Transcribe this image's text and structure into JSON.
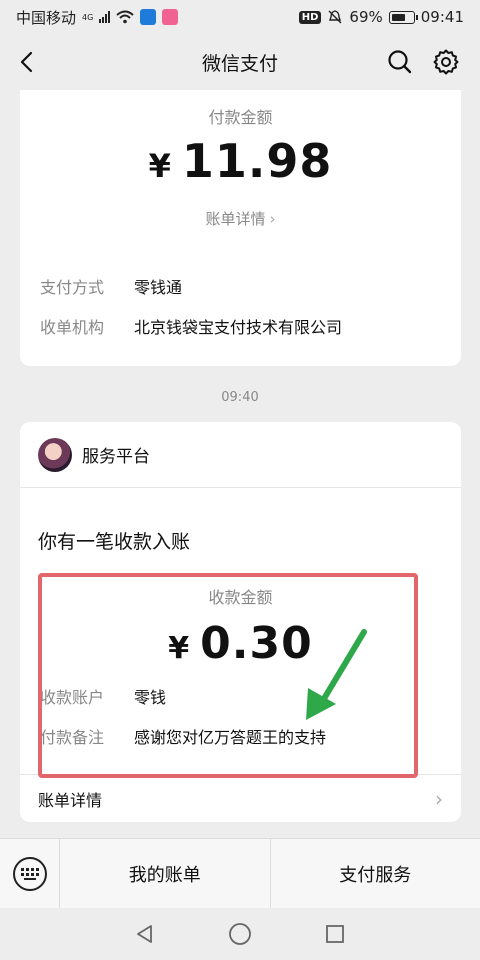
{
  "status_bar": {
    "carrier": "中国移动",
    "network": "4G",
    "battery": "69%",
    "battery_level": 0.69,
    "time": "09:41",
    "hd": "HD"
  },
  "nav": {
    "title": "微信支付",
    "icons": [
      "back-icon",
      "search-icon",
      "gear-icon"
    ]
  },
  "payment_card": {
    "amount_label": "付款金额",
    "currency": "¥",
    "amount": "11.98",
    "bill_detail": "账单详情",
    "bill_detail_chevron": "›",
    "rows": [
      {
        "key": "支付方式",
        "value": "零钱通"
      },
      {
        "key": "收单机构",
        "value": "北京钱袋宝支付技术有限公司"
      }
    ]
  },
  "time_separator": "09:40",
  "receipt_card": {
    "service_name": "服务平台",
    "notice": "你有一笔收款入账",
    "amount_label": "收款金额",
    "currency": "¥",
    "amount": "0.30",
    "rows": [
      {
        "key": "收款账户",
        "value": "零钱"
      },
      {
        "key": "付款备注",
        "value": "感谢您对亿万答题王的支持"
      }
    ],
    "bill_detail": "账单详情",
    "bill_detail_chevron": "›"
  },
  "bottom_menu": {
    "items": [
      "我的账单",
      "支付服务"
    ]
  },
  "colors": {
    "background": "#ededed",
    "highlight_box": "#e2666b",
    "arrow": "#2fa84a"
  }
}
